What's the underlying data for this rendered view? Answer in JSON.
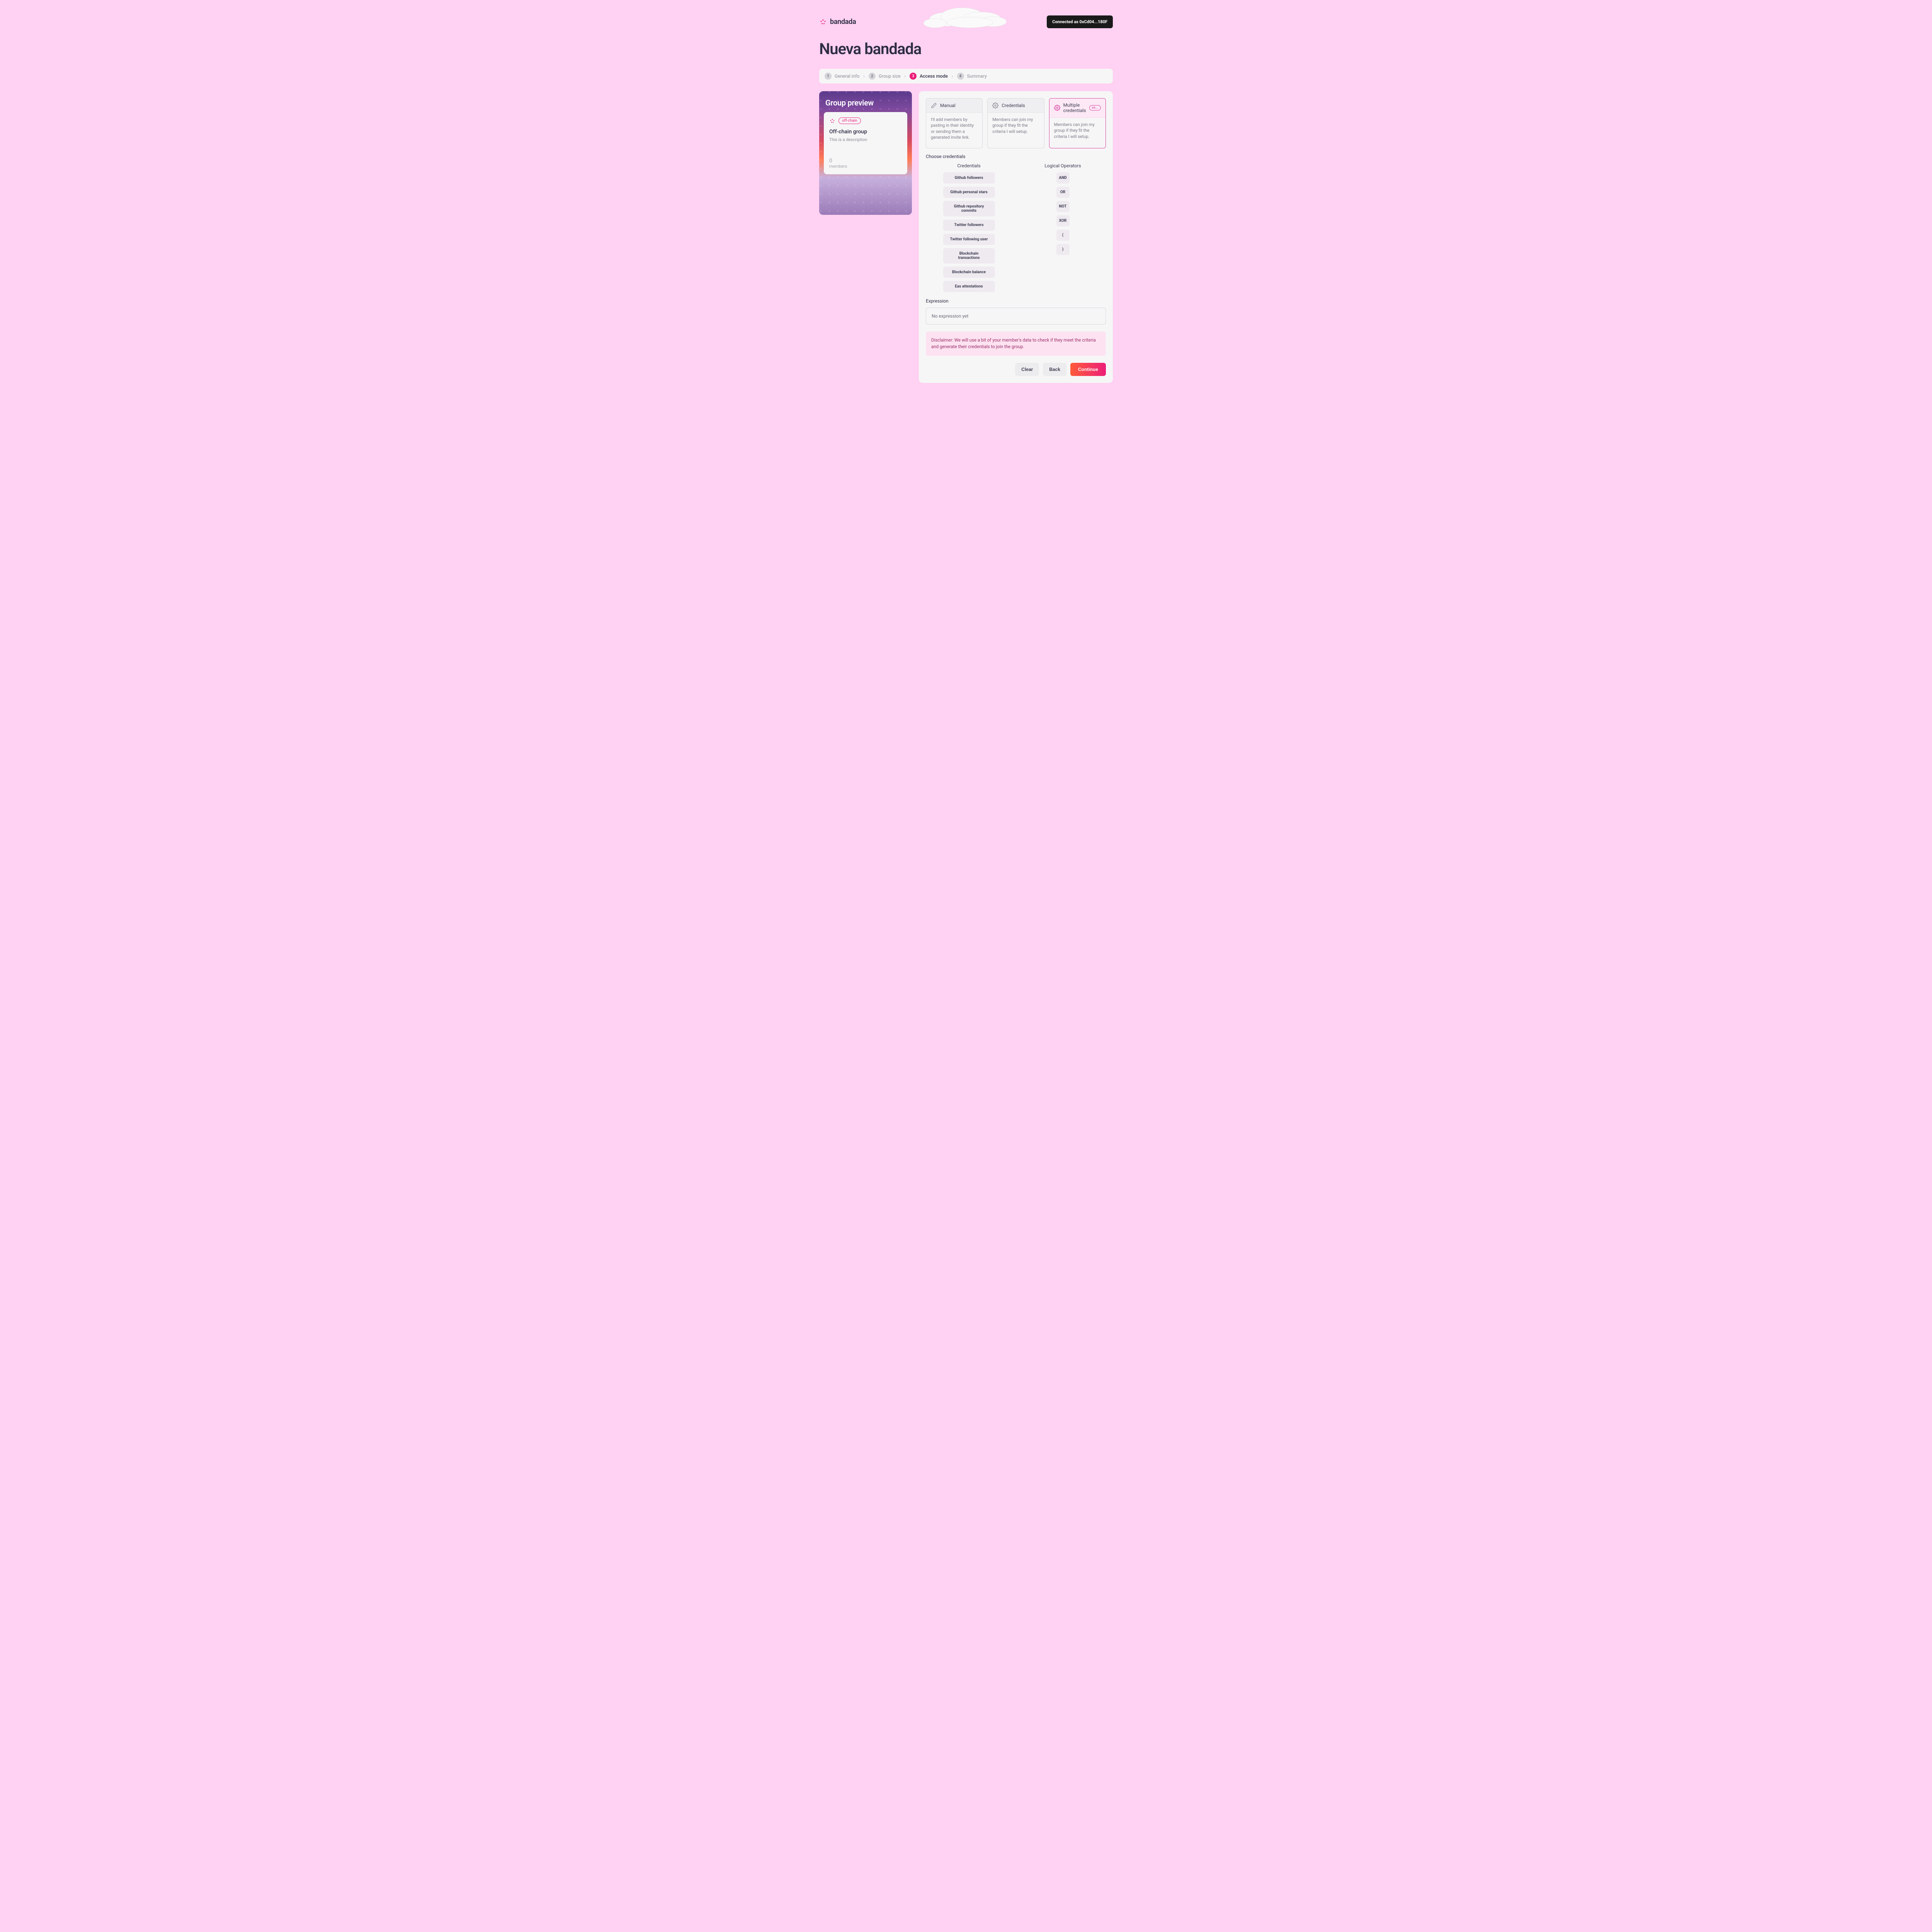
{
  "brand": "bandada",
  "wallet": "Connected as 0xCd04...180F",
  "page_title": "Nueva bandada",
  "stepper": {
    "steps": [
      {
        "num": "1",
        "label": "General info"
      },
      {
        "num": "2",
        "label": "Group size"
      },
      {
        "num": "3",
        "label": "Access mode"
      },
      {
        "num": "4",
        "label": "Summary"
      }
    ],
    "active_index": 2
  },
  "preview": {
    "heading": "Group preview",
    "tag": "off-chain",
    "name": "Off-chain group",
    "description": "This is a description",
    "count": "0",
    "count_label": "members"
  },
  "access_modes": [
    {
      "id": "manual",
      "icon": "pencil-icon",
      "title": "Manual",
      "body": "I'll add members by pasting in their identity or sending them a generated invite link.",
      "selected": false
    },
    {
      "id": "credentials",
      "icon": "gear-icon",
      "title": "Credentials",
      "body": "Members can join my group if they fit the criteria I will setup.",
      "selected": false
    },
    {
      "id": "multiple",
      "icon": "gear-icon",
      "title": "Multiple credentials",
      "body": "Members can join my group if they fit the criteria I will setup.",
      "selected": true,
      "selected_label": "selected"
    }
  ],
  "choose_label": "Choose credentials",
  "columns": {
    "credentials": {
      "heading": "Credentials",
      "items": [
        "Github followers",
        "Github personal stars",
        "Github repository commits",
        "Twitter followers",
        "Twitter following user",
        "Blockchain transactions",
        "Blockchain balance",
        "Eas attestations"
      ]
    },
    "operators": {
      "heading": "Logical Operators",
      "items": [
        "AND",
        "OR",
        "NOT",
        "XOR",
        "(",
        ")"
      ]
    }
  },
  "expression": {
    "label": "Expression",
    "placeholder": "No expression yet"
  },
  "disclaimer": "Disclaimer: We will use a bit of your member's data to check if they meet the criteria and generate their credentials to join the group.",
  "buttons": {
    "clear": "Clear",
    "back": "Back",
    "continue": "Continue"
  }
}
